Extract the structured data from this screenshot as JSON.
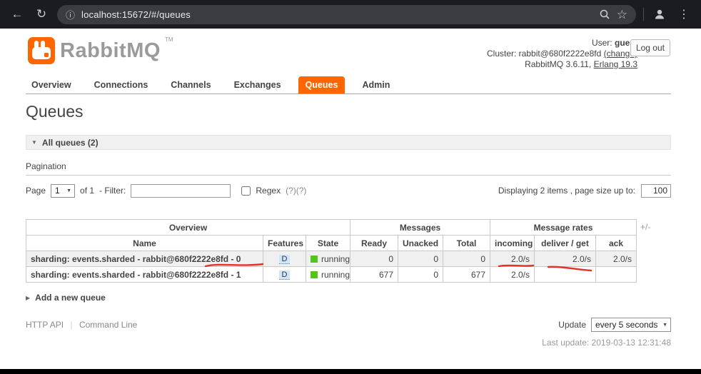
{
  "browser": {
    "url": "localhost:15672/#/queues"
  },
  "header": {
    "logo_text": "RabbitMQ",
    "logo_tm": "TM",
    "user_label": "User:",
    "user_value": "guest",
    "logout_label": "Log out",
    "cluster_label": "Cluster:",
    "cluster_value": "rabbit@680f2222e8fd",
    "cluster_change_link": "(change)",
    "version_prefix": "RabbitMQ 3.6.11,",
    "version_erlang": "Erlang 19.3"
  },
  "tabs": [
    {
      "label": "Overview"
    },
    {
      "label": "Connections"
    },
    {
      "label": "Channels"
    },
    {
      "label": "Exchanges"
    },
    {
      "label": "Queues"
    },
    {
      "label": "Admin"
    }
  ],
  "page": {
    "title": "Queues",
    "all_queues_label": "All queues (2)",
    "pagination_label": "Pagination",
    "page_label": "Page",
    "page_selected": "1",
    "of_label": "of 1",
    "filter_label": "- Filter:",
    "filter_value": "",
    "regex_label": "Regex",
    "regex_help": "(?)(?)",
    "displaying_label": "Displaying 2 items , page size up to:",
    "page_size_value": "100",
    "plus_minus": "+/-",
    "add_queue_label": "Add a new queue"
  },
  "table": {
    "group_headers": [
      {
        "label": "Overview"
      },
      {
        "label": "Messages"
      },
      {
        "label": "Message rates"
      }
    ],
    "columns": [
      "Name",
      "Features",
      "State",
      "Ready",
      "Unacked",
      "Total",
      "incoming",
      "deliver / get",
      "ack"
    ],
    "rows": [
      {
        "name": "sharding: events.sharded - rabbit@680f2222e8fd - 0",
        "features": "D",
        "state": "running",
        "ready": "0",
        "unacked": "0",
        "total": "0",
        "incoming": "2.0/s",
        "deliver_get": "2.0/s",
        "ack": "2.0/s"
      },
      {
        "name": "sharding: events.sharded - rabbit@680f2222e8fd - 1",
        "features": "D",
        "state": "running",
        "ready": "677",
        "unacked": "0",
        "total": "677",
        "incoming": "2.0/s",
        "deliver_get": "",
        "ack": ""
      }
    ]
  },
  "footer": {
    "http_api_label": "HTTP API",
    "command_line_label": "Command Line",
    "update_label": "Update",
    "update_value": "every 5 seconds",
    "last_update": "Last update: 2019-03-13 12:31:48"
  },
  "colors": {
    "accent_orange": "#ff6600",
    "state_green": "#52c41a",
    "annotation_red": "#e0332a"
  }
}
